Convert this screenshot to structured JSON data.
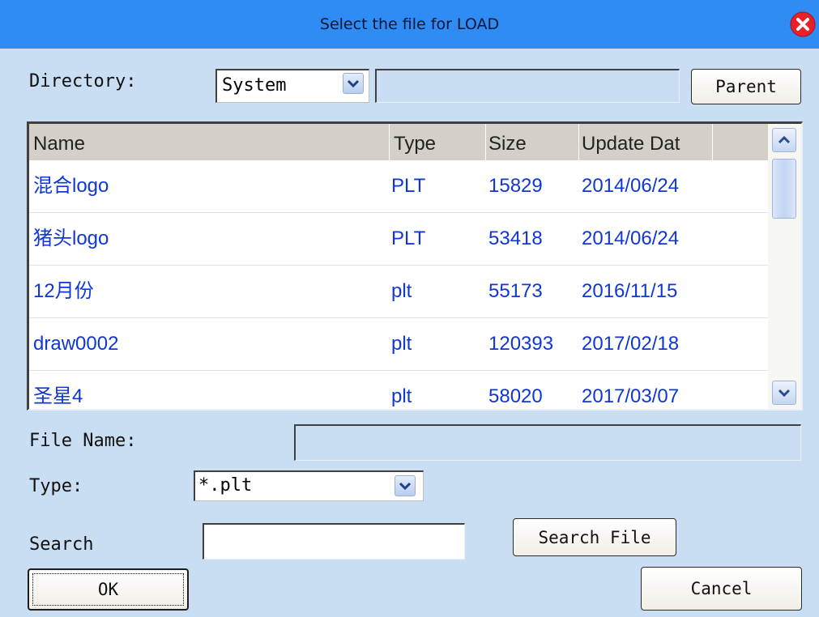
{
  "window": {
    "title": "Select the file for LOAD"
  },
  "directory": {
    "label": "Directory:",
    "value": "System",
    "path": "",
    "parent_label": "Parent"
  },
  "file_list": {
    "columns": [
      "Name",
      "Type",
      "Size",
      "Update Dat"
    ],
    "rows": [
      {
        "name": "混合logo",
        "type": "PLT",
        "size": "15829",
        "date": "2014/06/24"
      },
      {
        "name": "猪头logo",
        "type": "PLT",
        "size": "53418",
        "date": "2014/06/24"
      },
      {
        "name": "12月份",
        "type": "plt",
        "size": "55173",
        "date": "2016/11/15"
      },
      {
        "name": "draw0002",
        "type": "plt",
        "size": "120393",
        "date": "2017/02/18"
      },
      {
        "name": "圣星4",
        "type": "plt",
        "size": "58020",
        "date": "2017/03/07"
      }
    ]
  },
  "file_name": {
    "label": "File Name:",
    "value": ""
  },
  "type_filter": {
    "label": "Type:",
    "value": "*.plt"
  },
  "search": {
    "label": "Search",
    "value": "",
    "button_label": "Search File"
  },
  "actions": {
    "ok_label": "OK",
    "cancel_label": "Cancel"
  },
  "colors": {
    "title_bar": "#2f8cf5",
    "background": "#c9def3",
    "list_text": "#1037d6",
    "close": "#e8202a"
  },
  "icons": {
    "close": "close-icon",
    "dropdown": "chevron-down-icon",
    "scroll_up": "arrow-up-icon",
    "scroll_down": "arrow-down-icon"
  }
}
